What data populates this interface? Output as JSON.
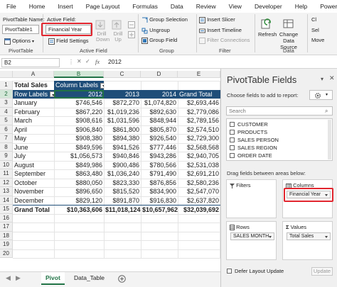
{
  "menubar": [
    "File",
    "Home",
    "Insert",
    "Page Layout",
    "Formulas",
    "Data",
    "Review",
    "View",
    "Developer",
    "Help",
    "Power Pivot"
  ],
  "ribbon": {
    "pivottable_name_label": "PivotTable Name:",
    "pivottable_name_value": "PivotTable1",
    "options_label": "Options",
    "group_pivottable": "PivotTable",
    "active_field_label": "Active Field:",
    "active_field_value": "Financial Year",
    "field_settings_label": "Field Settings",
    "drill_down_label": "Drill Down",
    "drill_up_label": "Drill Up",
    "group_active_field": "Active Field",
    "group_selection_label": "Group Selection",
    "ungroup_label": "Ungroup",
    "group_field_label": "Group Field",
    "group_group": "Group",
    "insert_slicer_label": "Insert Slicer",
    "insert_timeline_label": "Insert Timeline",
    "filter_connections_label": "Filter Connections",
    "group_filter": "Filter",
    "refresh_label": "Refresh",
    "change_data_source_label": "Change Data Source",
    "group_data": "Data",
    "clear_label": "Cl",
    "select_label": "Sel",
    "move_label": "Move"
  },
  "formula_bar": {
    "cell_ref": "B2",
    "fx_label": "fx",
    "value": "2012"
  },
  "sheet": {
    "columns": [
      "A",
      "B",
      "C",
      "D",
      "E"
    ],
    "rows": [
      "1",
      "2",
      "3",
      "4",
      "5",
      "6",
      "7",
      "8",
      "9",
      "10",
      "11",
      "12",
      "13",
      "14",
      "15",
      "16",
      "17",
      "18",
      "19",
      "20"
    ],
    "row1": {
      "a": "Total Sales",
      "b": "Column Labels"
    },
    "row2": {
      "a": "Row Labels",
      "b": "2012",
      "c": "2013",
      "d": "2014",
      "e": "Grand Total"
    },
    "data": [
      {
        "month": "January",
        "y2012": "$746,546",
        "y2013": "$872,270",
        "y2014": "$1,074,820",
        "total": "$2,693,446"
      },
      {
        "month": "February",
        "y2012": "$867,220",
        "y2013": "$1,019,236",
        "y2014": "$892,630",
        "total": "$2,779,086"
      },
      {
        "month": "March",
        "y2012": "$908,616",
        "y2013": "$1,031,596",
        "y2014": "$848,944",
        "total": "$2,789,156"
      },
      {
        "month": "April",
        "y2012": "$906,840",
        "y2013": "$861,800",
        "y2014": "$805,870",
        "total": "$2,574,510"
      },
      {
        "month": "May",
        "y2012": "$908,380",
        "y2013": "$894,380",
        "y2014": "$926,540",
        "total": "$2,729,300"
      },
      {
        "month": "June",
        "y2012": "$849,596",
        "y2013": "$941,526",
        "y2014": "$777,446",
        "total": "$2,568,568"
      },
      {
        "month": "July",
        "y2012": "$1,056,573",
        "y2013": "$940,846",
        "y2014": "$943,286",
        "total": "$2,940,705"
      },
      {
        "month": "August",
        "y2012": "$849,986",
        "y2013": "$900,486",
        "y2014": "$780,566",
        "total": "$2,531,038"
      },
      {
        "month": "September",
        "y2012": "$863,480",
        "y2013": "$1,036,240",
        "y2014": "$791,490",
        "total": "$2,691,210"
      },
      {
        "month": "October",
        "y2012": "$880,050",
        "y2013": "$823,330",
        "y2014": "$876,856",
        "total": "$2,580,236"
      },
      {
        "month": "November",
        "y2012": "$896,650",
        "y2013": "$815,520",
        "y2014": "$834,900",
        "total": "$2,547,070"
      },
      {
        "month": "December",
        "y2012": "$829,120",
        "y2013": "$891,870",
        "y2014": "$916,830",
        "total": "$2,637,820"
      }
    ],
    "grand_total": {
      "label": "Grand Total",
      "y2012": "$10,363,606",
      "y2013": "$11,018,124",
      "y2014": "$10,657,962",
      "total": "$32,039,692"
    }
  },
  "tabs": {
    "active": "Pivot",
    "other": "Data_Table"
  },
  "panel": {
    "title": "PivotTable Fields",
    "choose_label": "Choose fields to add to report:",
    "search_placeholder": "Search",
    "fields": [
      "CUSTOMER",
      "PRODUCTS",
      "SALES PERSON",
      "SALES REGION",
      "ORDER DATE"
    ],
    "drag_label": "Drag fields between areas below:",
    "filters_label": "Filters",
    "columns_label": "Columns",
    "columns_pill": "Financial Year",
    "rows_label": "Rows",
    "rows_pill": "SALES MONTH",
    "values_label": "Values",
    "values_pill": "Total Sales",
    "defer_label": "Defer Layout Update",
    "update_label": "Update"
  },
  "colors": {
    "accent_green": "#217346",
    "header_band": "#1f4e79",
    "highlight_red": "#e2262f"
  }
}
